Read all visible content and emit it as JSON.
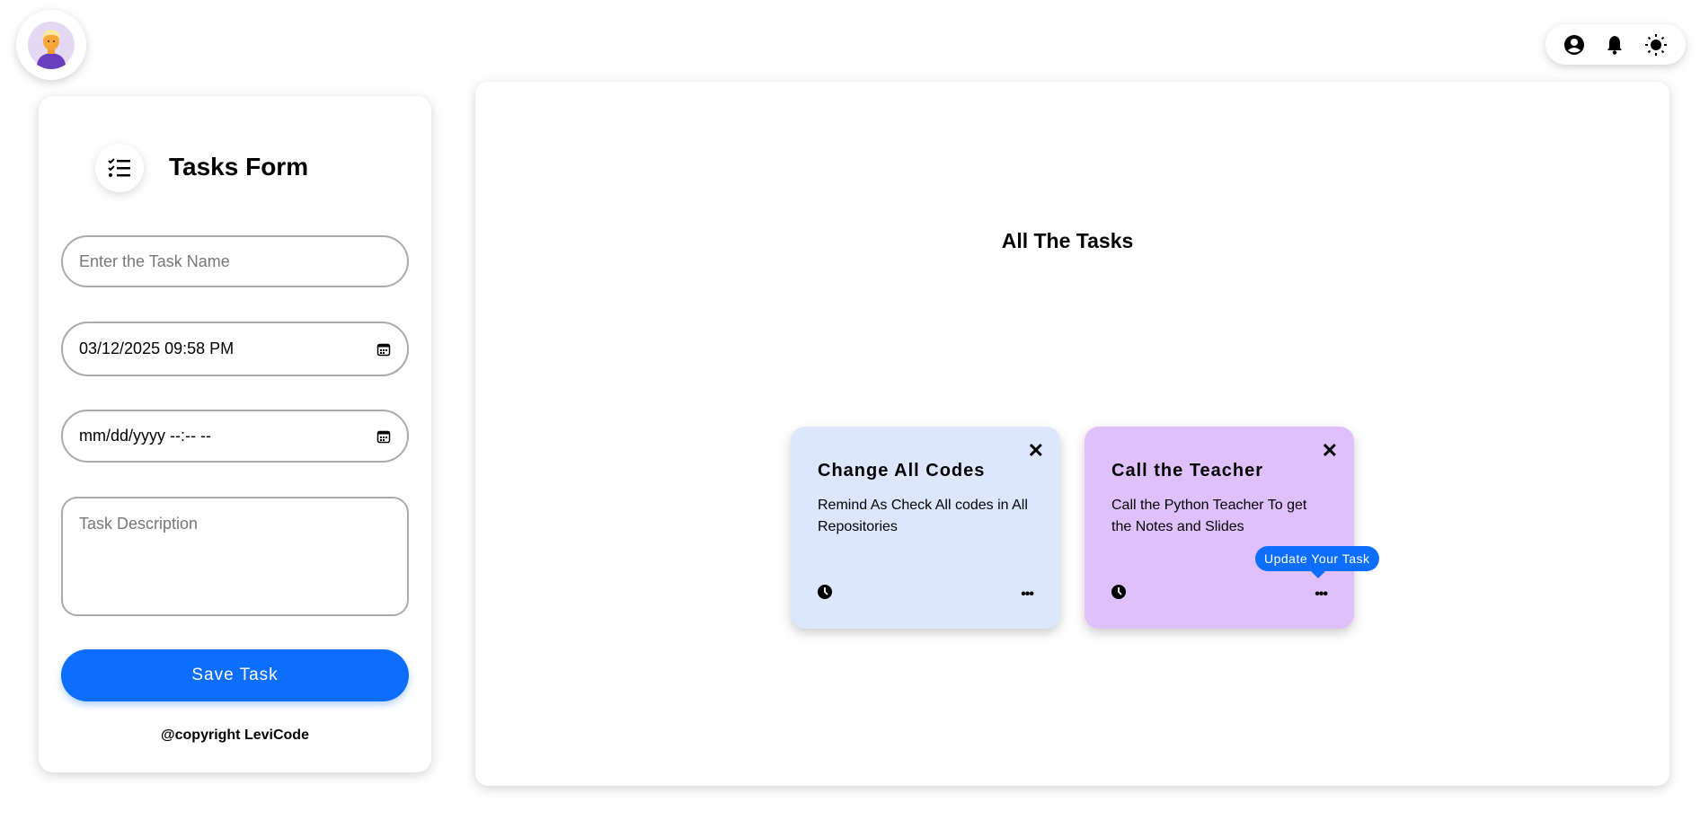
{
  "form": {
    "title": "Tasks Form",
    "task_name_placeholder": "Enter the Task Name",
    "start_datetime_value": "03/12/2025 09:58 PM",
    "end_datetime_value": "mm/dd/yyyy --:-- --",
    "description_placeholder": "Task Description",
    "save_label": "Save Task",
    "copyright": "@copyright LeviCode"
  },
  "main": {
    "title": "All The Tasks",
    "tasks": [
      {
        "title": "Change All Codes",
        "description": "Remind As Check All codes in All Repositories",
        "color": "#dce7fd"
      },
      {
        "title": "Call the Teacher",
        "description": "Call the Python Teacher To get the Notes and Slides",
        "color": "#dfc0fb"
      }
    ],
    "tooltip": "Update Your Task"
  },
  "colors": {
    "accent": "#0d6efd"
  }
}
